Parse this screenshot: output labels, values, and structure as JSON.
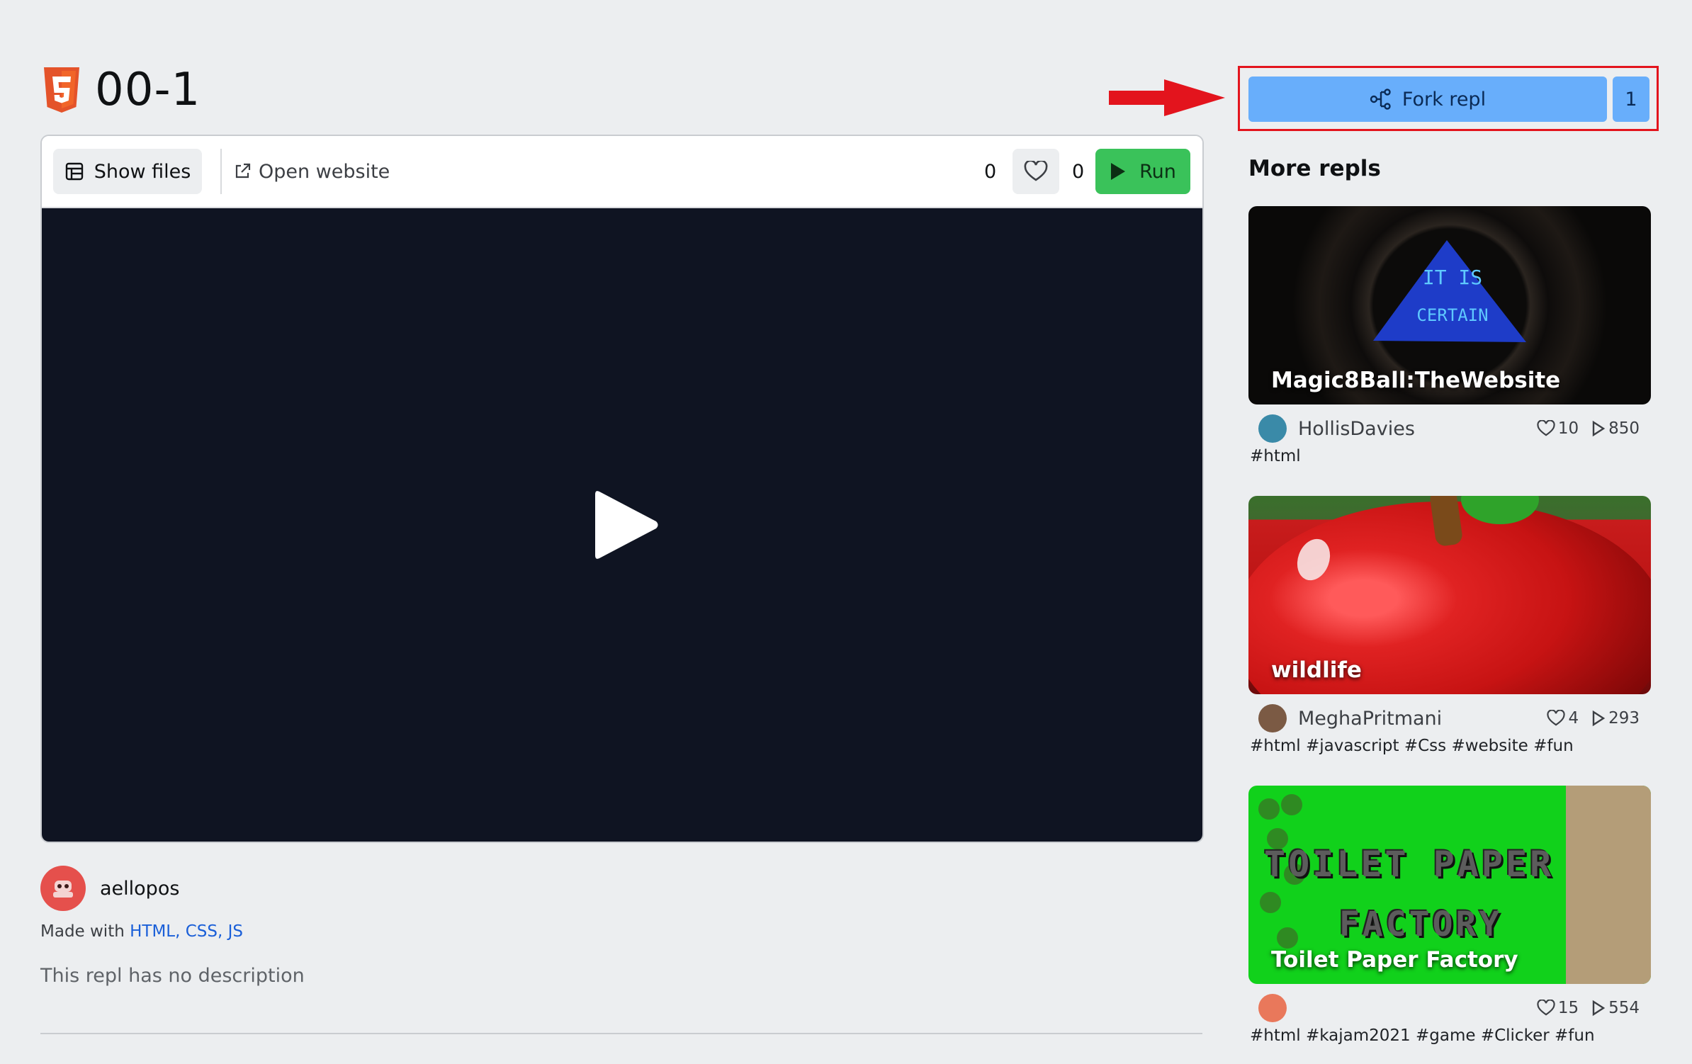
{
  "page": {
    "title": "00-1"
  },
  "toolbar": {
    "show_files": "Show files",
    "open_website": "Open website",
    "count_left": "0",
    "count_right": "0",
    "run": "Run"
  },
  "author": {
    "name": "aellopos",
    "made_with_prefix": "Made with",
    "made_with_langs": "HTML, CSS, JS",
    "description": "This repl has no description"
  },
  "fork": {
    "label": "Fork repl",
    "count": "1"
  },
  "more_repls": {
    "title": "More repls",
    "items": [
      {
        "title": "Magic8Ball:TheWebsite",
        "thumb_text_1": "IT IS",
        "thumb_text_2": "CERTAIN",
        "user": "HollisDavies",
        "likes": "10",
        "runs": "850",
        "tags": "#html"
      },
      {
        "title": "wildlife",
        "user": "MeghaPritmani",
        "likes": "4",
        "runs": "293",
        "tags": "#html #javascript #Css #website #fun"
      },
      {
        "title": "Toilet Paper Factory",
        "thumb_text_1": "TOILET PAPER",
        "thumb_text_2": "FACTORY",
        "user": "",
        "likes": "15",
        "runs": "554",
        "tags": "#html #kajam2021 #game #Clicker #fun"
      }
    ]
  },
  "colors": {
    "accent_blue": "#68aefb",
    "run_green": "#3ac25a",
    "annotation_red": "#e3141d",
    "preview_bg": "#0f1422"
  },
  "icons": [
    "html5-icon",
    "file-tree-icon",
    "external-link-icon",
    "heart-icon",
    "play-icon",
    "fork-icon",
    "arrow-annotation"
  ]
}
